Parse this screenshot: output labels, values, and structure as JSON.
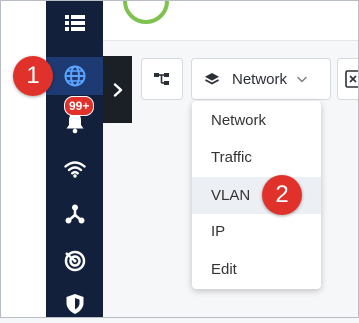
{
  "toolbar": {
    "layer_select": {
      "value": "Network"
    }
  },
  "dropdown": {
    "options": [
      "Network",
      "Traffic",
      "VLAN",
      "IP",
      "Edit"
    ],
    "hovered": "VLAN"
  },
  "sidebar": {
    "items": [
      {
        "icon": "list-icon"
      },
      {
        "icon": "globe-icon",
        "active": true
      },
      {
        "icon": "bell-icon",
        "badge": "99+"
      },
      {
        "icon": "wifi-icon"
      },
      {
        "icon": "topology-icon"
      },
      {
        "icon": "radar-icon"
      },
      {
        "icon": "shield-icon"
      }
    ]
  },
  "callouts": {
    "step1": "1",
    "step2": "2"
  },
  "colors": {
    "sidebar_bg": "#13203b",
    "active_item_bg": "#1d3a73",
    "callout_red": "#e0322b",
    "logo_green": "#7ec24f"
  }
}
